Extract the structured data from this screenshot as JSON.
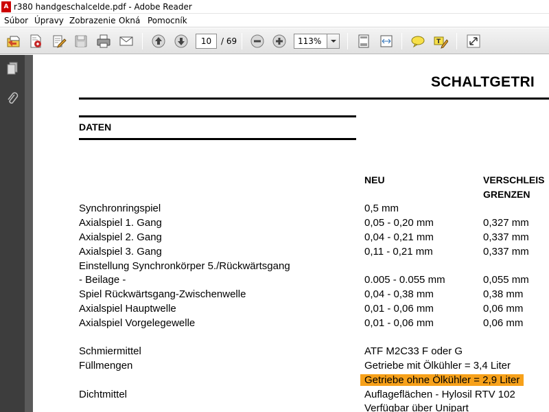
{
  "window": {
    "title": "r380 handgeschalcelde.pdf - Adobe Reader"
  },
  "menu": [
    "Súbor",
    "Úpravy",
    "Zobrazenie",
    "Okná",
    "Pomocník"
  ],
  "toolbar": {
    "page_current": "10",
    "page_total": "/ 69",
    "zoom": "113%",
    "icons": [
      "open-icon",
      "create-pdf-icon",
      "edit-icon",
      "save-icon",
      "print-icon",
      "email-icon",
      "prev-page-icon",
      "next-page-icon",
      "zoom-out-icon",
      "zoom-in-icon",
      "fit-page-icon",
      "fit-width-icon",
      "comment-icon",
      "highlight-text-icon",
      "expand-icon"
    ]
  },
  "sidebar": {
    "icons": [
      "pages-icon",
      "attachment-icon"
    ]
  },
  "document": {
    "title": "SCHALTGETRI",
    "section": "DATEN",
    "col_new": "NEU",
    "col_wear_1": "VERSCHLEIS",
    "col_wear_2": "GRENZEN",
    "rows": [
      {
        "label": "Synchronringspiel",
        "new": "0,5 mm",
        "wear": ""
      },
      {
        "label": "Axialspiel 1. Gang",
        "new": "0,05 - 0,20 mm",
        "wear": "0,327 mm"
      },
      {
        "label": "Axialspiel 2. Gang",
        "new": "0,04 - 0,21 mm",
        "wear": "0,337 mm"
      },
      {
        "label": "Axialspiel 3. Gang",
        "new": "0,11 - 0,21 mm",
        "wear": "0,337 mm"
      },
      {
        "label": "Einstellung Synchronkörper 5./Rückwärtsgang",
        "new": "",
        "wear": ""
      },
      {
        "label": "- Beilage -",
        "new": "0.005 - 0.055 mm",
        "wear": "0,055 mm"
      },
      {
        "label": "Spiel Rückwärtsgang-Zwischenwelle",
        "new": "0,04 - 0,38 mm",
        "wear": "0,38 mm"
      },
      {
        "label": "Axialspiel Hauptwelle",
        "new": "0,01 - 0,06 mm",
        "wear": "0,06 mm"
      },
      {
        "label": "Axialspiel Vorgelegewelle",
        "new": "0,01 - 0,06 mm",
        "wear": "0,06 mm"
      }
    ],
    "rows2": [
      {
        "label": "Schmiermittel",
        "value": "ATF M2C33 F oder G"
      },
      {
        "label": "Füllmengen",
        "value": "Getriebe mit Ölkühler = 3,4 Liter"
      },
      {
        "label": "",
        "value": "Getriebe ohne Ölkühler = 2,9 Liter",
        "highlighted": true
      },
      {
        "label": "Dichtmittel",
        "value": "Auflageflächen - Hylosil RTV 102"
      },
      {
        "label": "",
        "value": "Verfügbar über Unipart"
      }
    ],
    "highlight_color": "#f7a11a"
  }
}
